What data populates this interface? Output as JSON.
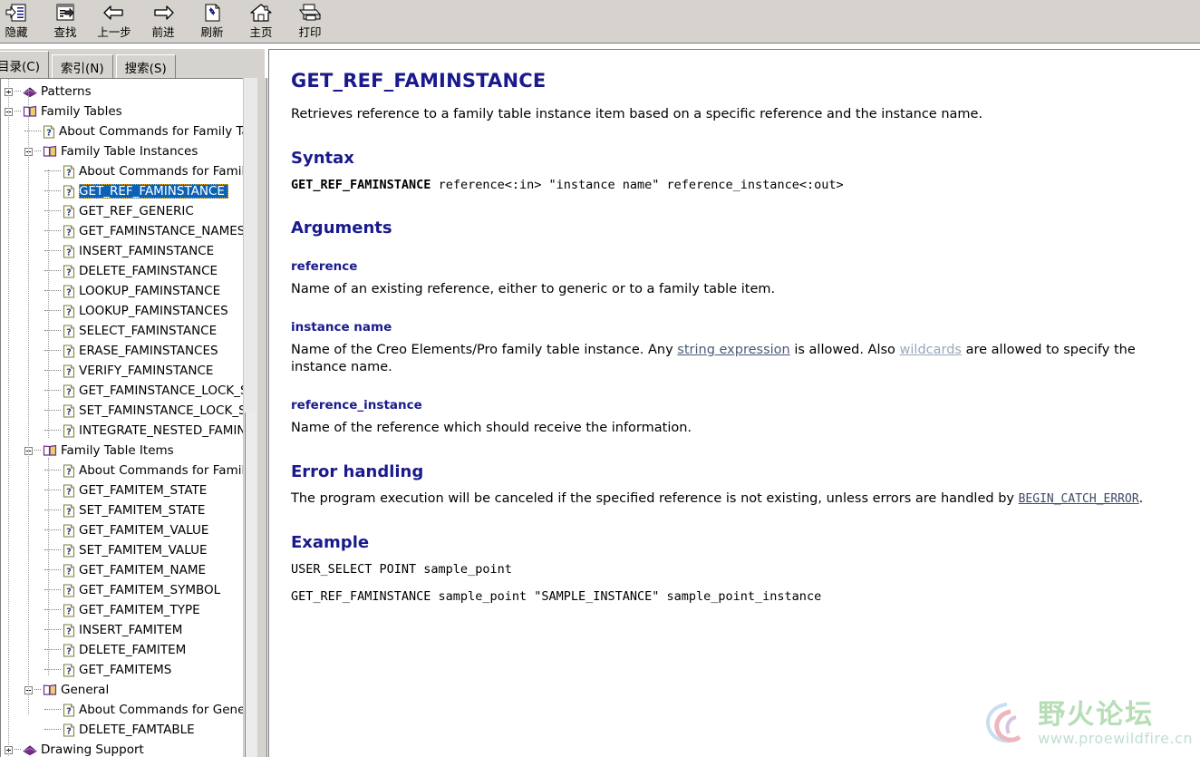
{
  "toolbar": {
    "buttons": [
      {
        "label": "隐藏",
        "icon": "hide-pane-icon"
      },
      {
        "label": "查找",
        "icon": "find-icon"
      },
      {
        "label": "上一步",
        "icon": "back-arrow-icon"
      },
      {
        "label": "前进",
        "icon": "forward-arrow-icon"
      },
      {
        "label": "刷新",
        "icon": "refresh-icon"
      },
      {
        "label": "主页",
        "icon": "home-icon"
      },
      {
        "label": "打印",
        "icon": "print-icon"
      }
    ]
  },
  "tabs": [
    {
      "label": "目录(C)",
      "text": "目录(",
      "accel": "C",
      "tail": ")",
      "active": true
    },
    {
      "label": "索引(N)",
      "text": "索引(",
      "accel": "N",
      "tail": ")",
      "active": false
    },
    {
      "label": "搜索(S)",
      "text": "搜索(",
      "accel": "S",
      "tail": ")",
      "active": false
    }
  ],
  "tree": {
    "selected": "GET_REF_FAMINSTANCE",
    "nodes": [
      {
        "label": "Patterns",
        "type": "book-closed",
        "depth": 0,
        "toggle": "plus",
        "selected": false
      },
      {
        "label": "Family Tables",
        "type": "book-open",
        "depth": 0,
        "toggle": "minus",
        "selected": false
      },
      {
        "label": "About Commands for Family Tab",
        "type": "topic",
        "depth": 1,
        "toggle": "none",
        "selected": false
      },
      {
        "label": "Family Table Instances",
        "type": "book-open",
        "depth": 1,
        "toggle": "minus",
        "selected": false
      },
      {
        "label": "About Commands for Family ",
        "type": "topic",
        "depth": 2,
        "toggle": "none",
        "selected": false
      },
      {
        "label": "GET_REF_FAMINSTANCE",
        "type": "topic",
        "depth": 2,
        "toggle": "none",
        "selected": true
      },
      {
        "label": "GET_REF_GENERIC",
        "type": "topic",
        "depth": 2,
        "toggle": "none",
        "selected": false
      },
      {
        "label": "GET_FAMINSTANCE_NAMES",
        "type": "topic",
        "depth": 2,
        "toggle": "none",
        "selected": false
      },
      {
        "label": "INSERT_FAMINSTANCE",
        "type": "topic",
        "depth": 2,
        "toggle": "none",
        "selected": false
      },
      {
        "label": "DELETE_FAMINSTANCE",
        "type": "topic",
        "depth": 2,
        "toggle": "none",
        "selected": false
      },
      {
        "label": "LOOKUP_FAMINSTANCE",
        "type": "topic",
        "depth": 2,
        "toggle": "none",
        "selected": false
      },
      {
        "label": "LOOKUP_FAMINSTANCES",
        "type": "topic",
        "depth": 2,
        "toggle": "none",
        "selected": false
      },
      {
        "label": "SELECT_FAMINSTANCE",
        "type": "topic",
        "depth": 2,
        "toggle": "none",
        "selected": false
      },
      {
        "label": "ERASE_FAMINSTANCES",
        "type": "topic",
        "depth": 2,
        "toggle": "none",
        "selected": false
      },
      {
        "label": "VERIFY_FAMINSTANCE",
        "type": "topic",
        "depth": 2,
        "toggle": "none",
        "selected": false
      },
      {
        "label": "GET_FAMINSTANCE_LOCK_ST",
        "type": "topic",
        "depth": 2,
        "toggle": "none",
        "selected": false
      },
      {
        "label": "SET_FAMINSTANCE_LOCK_ST",
        "type": "topic",
        "depth": 2,
        "toggle": "none",
        "selected": false
      },
      {
        "label": "INTEGRATE_NESTED_FAMINS",
        "type": "topic",
        "depth": 2,
        "toggle": "none",
        "selected": false
      },
      {
        "label": "Family Table Items",
        "type": "book-open",
        "depth": 1,
        "toggle": "minus",
        "selected": false
      },
      {
        "label": "About Commands for Family ",
        "type": "topic",
        "depth": 2,
        "toggle": "none",
        "selected": false
      },
      {
        "label": "GET_FAMITEM_STATE",
        "type": "topic",
        "depth": 2,
        "toggle": "none",
        "selected": false
      },
      {
        "label": "SET_FAMITEM_STATE",
        "type": "topic",
        "depth": 2,
        "toggle": "none",
        "selected": false
      },
      {
        "label": "GET_FAMITEM_VALUE",
        "type": "topic",
        "depth": 2,
        "toggle": "none",
        "selected": false
      },
      {
        "label": "SET_FAMITEM_VALUE",
        "type": "topic",
        "depth": 2,
        "toggle": "none",
        "selected": false
      },
      {
        "label": "GET_FAMITEM_NAME",
        "type": "topic",
        "depth": 2,
        "toggle": "none",
        "selected": false
      },
      {
        "label": "GET_FAMITEM_SYMBOL",
        "type": "topic",
        "depth": 2,
        "toggle": "none",
        "selected": false
      },
      {
        "label": "GET_FAMITEM_TYPE",
        "type": "topic",
        "depth": 2,
        "toggle": "none",
        "selected": false
      },
      {
        "label": "INSERT_FAMITEM",
        "type": "topic",
        "depth": 2,
        "toggle": "none",
        "selected": false
      },
      {
        "label": "DELETE_FAMITEM",
        "type": "topic",
        "depth": 2,
        "toggle": "none",
        "selected": false
      },
      {
        "label": "GET_FAMITEMS",
        "type": "topic",
        "depth": 2,
        "toggle": "none",
        "selected": false
      },
      {
        "label": "General",
        "type": "book-open",
        "depth": 1,
        "toggle": "minus",
        "selected": false
      },
      {
        "label": "About Commands for Genera",
        "type": "topic",
        "depth": 2,
        "toggle": "none",
        "selected": false
      },
      {
        "label": "DELETE_FAMTABLE",
        "type": "topic",
        "depth": 2,
        "toggle": "none",
        "selected": false
      },
      {
        "label": "Drawing Support",
        "type": "book-closed",
        "depth": 0,
        "toggle": "plus",
        "selected": false
      }
    ]
  },
  "document": {
    "title": "GET_REF_FAMINSTANCE",
    "intro": "Retrieves reference to a family table instance item based on a specific reference and the instance name.",
    "syntax": {
      "heading": "Syntax",
      "command": "GET_REF_FAMINSTANCE",
      "params": " reference<:in> \"instance name\" reference_instance<:out>"
    },
    "arguments": {
      "heading": "Arguments",
      "items": [
        {
          "name": "reference",
          "desc": "Name of an existing reference, either to generic or to a family table item."
        },
        {
          "name": "instance name",
          "desc_part1": "Name of the Creo Elements/Pro family table instance. Any ",
          "link1": "string expression",
          "desc_part2": " is allowed. Also ",
          "link2": "wildcards",
          "desc_part3": " are allowed to specify the instance name."
        },
        {
          "name": "reference_instance",
          "desc": "Name of the reference which should receive the information."
        }
      ]
    },
    "error_handling": {
      "heading": "Error handling",
      "text_part1": "The program execution will be canceled if the specified reference is not existing, unless errors are handled by ",
      "link": "BEGIN_CATCH_ERROR",
      "text_part2": "."
    },
    "example": {
      "heading": "Example",
      "lines": [
        "USER_SELECT POINT sample_point",
        "GET_REF_FAMINSTANCE sample_point \"SAMPLE_INSTANCE\" sample_point_instance"
      ]
    }
  },
  "watermark": {
    "title": "野火论坛",
    "url": "www.proewildfire.cn"
  },
  "colors": {
    "heading": "#1a1a8c",
    "selection": "#0a62b8",
    "chrome": "#d6d3ce",
    "link": "#4a5a78",
    "link_visited": "#9aa6ba",
    "watermark_green": "#b6ddb6"
  }
}
